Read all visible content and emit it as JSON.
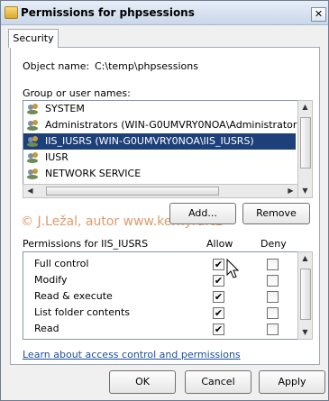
{
  "window": {
    "title": "Permissions for phpsessions",
    "close_symbol": "✕",
    "folder_icon": "folder-icon"
  },
  "tabs": [
    {
      "label": "Security"
    }
  ],
  "object_name": {
    "label": "Object name:",
    "value": "C:\\temp\\phpsessions"
  },
  "group_section": {
    "label": "Group or user names:",
    "users": [
      {
        "name": "SYSTEM",
        "icon": "user-group-icon",
        "selected": false
      },
      {
        "name": "Administrators (WIN-G0UMVRY0NOA\\Administrators)",
        "icon": "user-group-icon",
        "selected": false
      },
      {
        "name": "IIS_IUSRS (WIN-G0UMVRY0NOA\\IIS_IUSRS)",
        "icon": "user-group-icon",
        "selected": true
      },
      {
        "name": "IUSR",
        "icon": "user-group-icon",
        "selected": false
      },
      {
        "name": "NETWORK SERVICE",
        "icon": "user-group-icon",
        "selected": false
      }
    ]
  },
  "buttons": {
    "add": "Add...",
    "remove": "Remove",
    "ok": "OK",
    "cancel": "Cancel",
    "apply": "Apply"
  },
  "watermark": "© J.Ležal, autor www.kerhyra.cz",
  "permissions": {
    "label": "Permissions for IIS_IUSRS",
    "allow_label": "Allow",
    "deny_label": "Deny",
    "items": [
      {
        "name": "Full control",
        "allow": true,
        "deny": false
      },
      {
        "name": "Modify",
        "allow": true,
        "deny": false
      },
      {
        "name": "Read & execute",
        "allow": true,
        "deny": false
      },
      {
        "name": "List folder contents",
        "allow": true,
        "deny": false
      },
      {
        "name": "Read",
        "allow": true,
        "deny": false
      }
    ]
  },
  "help_link": "Learn about access control and permissions",
  "colors": {
    "selection": "#1d3f7a",
    "link": "#1a4d9a",
    "watermark": "#e09a68"
  },
  "glyphs": {
    "check": "✔",
    "up": "▲",
    "down": "▼",
    "left": "◀",
    "right": "▶"
  }
}
